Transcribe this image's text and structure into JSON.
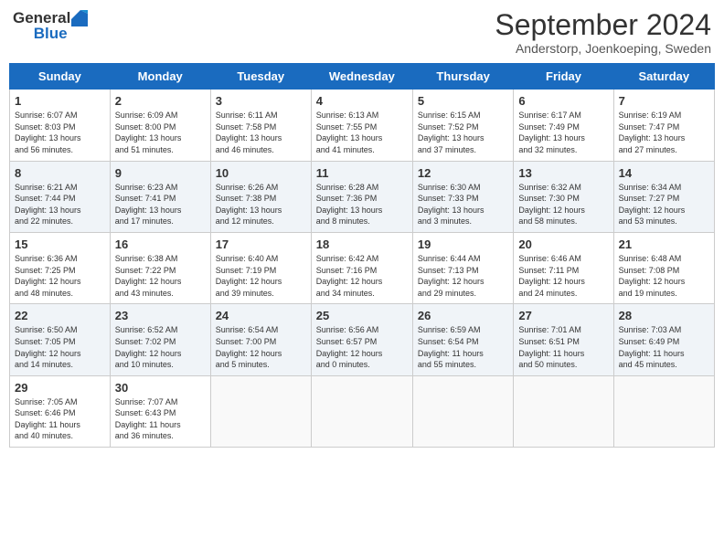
{
  "header": {
    "logo": {
      "general": "General",
      "blue": "Blue"
    },
    "title": "September 2024",
    "location": "Anderstorp, Joenkoeping, Sweden"
  },
  "weekdays": [
    "Sunday",
    "Monday",
    "Tuesday",
    "Wednesday",
    "Thursday",
    "Friday",
    "Saturday"
  ],
  "weeks": [
    [
      {
        "day": "1",
        "info": "Sunrise: 6:07 AM\nSunset: 8:03 PM\nDaylight: 13 hours\nand 56 minutes."
      },
      {
        "day": "2",
        "info": "Sunrise: 6:09 AM\nSunset: 8:00 PM\nDaylight: 13 hours\nand 51 minutes."
      },
      {
        "day": "3",
        "info": "Sunrise: 6:11 AM\nSunset: 7:58 PM\nDaylight: 13 hours\nand 46 minutes."
      },
      {
        "day": "4",
        "info": "Sunrise: 6:13 AM\nSunset: 7:55 PM\nDaylight: 13 hours\nand 41 minutes."
      },
      {
        "day": "5",
        "info": "Sunrise: 6:15 AM\nSunset: 7:52 PM\nDaylight: 13 hours\nand 37 minutes."
      },
      {
        "day": "6",
        "info": "Sunrise: 6:17 AM\nSunset: 7:49 PM\nDaylight: 13 hours\nand 32 minutes."
      },
      {
        "day": "7",
        "info": "Sunrise: 6:19 AM\nSunset: 7:47 PM\nDaylight: 13 hours\nand 27 minutes."
      }
    ],
    [
      {
        "day": "8",
        "info": "Sunrise: 6:21 AM\nSunset: 7:44 PM\nDaylight: 13 hours\nand 22 minutes."
      },
      {
        "day": "9",
        "info": "Sunrise: 6:23 AM\nSunset: 7:41 PM\nDaylight: 13 hours\nand 17 minutes."
      },
      {
        "day": "10",
        "info": "Sunrise: 6:26 AM\nSunset: 7:38 PM\nDaylight: 13 hours\nand 12 minutes."
      },
      {
        "day": "11",
        "info": "Sunrise: 6:28 AM\nSunset: 7:36 PM\nDaylight: 13 hours\nand 8 minutes."
      },
      {
        "day": "12",
        "info": "Sunrise: 6:30 AM\nSunset: 7:33 PM\nDaylight: 13 hours\nand 3 minutes."
      },
      {
        "day": "13",
        "info": "Sunrise: 6:32 AM\nSunset: 7:30 PM\nDaylight: 12 hours\nand 58 minutes."
      },
      {
        "day": "14",
        "info": "Sunrise: 6:34 AM\nSunset: 7:27 PM\nDaylight: 12 hours\nand 53 minutes."
      }
    ],
    [
      {
        "day": "15",
        "info": "Sunrise: 6:36 AM\nSunset: 7:25 PM\nDaylight: 12 hours\nand 48 minutes."
      },
      {
        "day": "16",
        "info": "Sunrise: 6:38 AM\nSunset: 7:22 PM\nDaylight: 12 hours\nand 43 minutes."
      },
      {
        "day": "17",
        "info": "Sunrise: 6:40 AM\nSunset: 7:19 PM\nDaylight: 12 hours\nand 39 minutes."
      },
      {
        "day": "18",
        "info": "Sunrise: 6:42 AM\nSunset: 7:16 PM\nDaylight: 12 hours\nand 34 minutes."
      },
      {
        "day": "19",
        "info": "Sunrise: 6:44 AM\nSunset: 7:13 PM\nDaylight: 12 hours\nand 29 minutes."
      },
      {
        "day": "20",
        "info": "Sunrise: 6:46 AM\nSunset: 7:11 PM\nDaylight: 12 hours\nand 24 minutes."
      },
      {
        "day": "21",
        "info": "Sunrise: 6:48 AM\nSunset: 7:08 PM\nDaylight: 12 hours\nand 19 minutes."
      }
    ],
    [
      {
        "day": "22",
        "info": "Sunrise: 6:50 AM\nSunset: 7:05 PM\nDaylight: 12 hours\nand 14 minutes."
      },
      {
        "day": "23",
        "info": "Sunrise: 6:52 AM\nSunset: 7:02 PM\nDaylight: 12 hours\nand 10 minutes."
      },
      {
        "day": "24",
        "info": "Sunrise: 6:54 AM\nSunset: 7:00 PM\nDaylight: 12 hours\nand 5 minutes."
      },
      {
        "day": "25",
        "info": "Sunrise: 6:56 AM\nSunset: 6:57 PM\nDaylight: 12 hours\nand 0 minutes."
      },
      {
        "day": "26",
        "info": "Sunrise: 6:59 AM\nSunset: 6:54 PM\nDaylight: 11 hours\nand 55 minutes."
      },
      {
        "day": "27",
        "info": "Sunrise: 7:01 AM\nSunset: 6:51 PM\nDaylight: 11 hours\nand 50 minutes."
      },
      {
        "day": "28",
        "info": "Sunrise: 7:03 AM\nSunset: 6:49 PM\nDaylight: 11 hours\nand 45 minutes."
      }
    ],
    [
      {
        "day": "29",
        "info": "Sunrise: 7:05 AM\nSunset: 6:46 PM\nDaylight: 11 hours\nand 40 minutes."
      },
      {
        "day": "30",
        "info": "Sunrise: 7:07 AM\nSunset: 6:43 PM\nDaylight: 11 hours\nand 36 minutes."
      },
      null,
      null,
      null,
      null,
      null
    ]
  ]
}
